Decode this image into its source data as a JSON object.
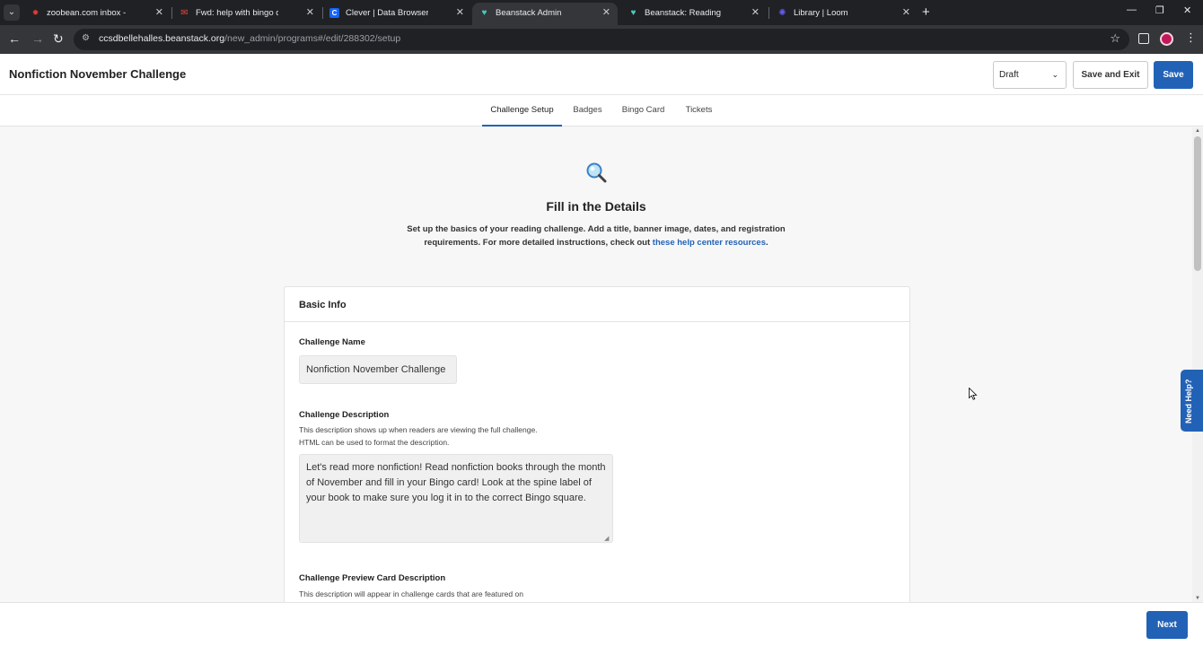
{
  "browser": {
    "tabs": [
      {
        "title": "zoobean.com inbox - App cras",
        "icon": "zoobean-icon",
        "active": false
      },
      {
        "title": "Fwd: help with bingo challeng",
        "icon": "gmail-icon",
        "active": false
      },
      {
        "title": "Clever | Data Browser",
        "icon": "clever-icon",
        "active": false
      },
      {
        "title": "Beanstack Admin",
        "icon": "beanstack-icon",
        "active": true
      },
      {
        "title": "Beanstack: Reading Challenges",
        "icon": "beanstack-icon",
        "active": false
      },
      {
        "title": "Library | Loom",
        "icon": "loom-icon",
        "active": false
      }
    ],
    "url_host": "ccsdbellehalles.beanstack.org",
    "url_path": "/new_admin/programs#/edit/288302/setup"
  },
  "header": {
    "title": "Nonfiction November Challenge",
    "status_value": "Draft",
    "save_exit_label": "Save and Exit",
    "save_label": "Save"
  },
  "content_tabs": [
    {
      "label": "Challenge Setup",
      "active": true
    },
    {
      "label": "Badges",
      "active": false
    },
    {
      "label": "Bingo Card",
      "active": false
    },
    {
      "label": "Tickets",
      "active": false
    }
  ],
  "intro": {
    "heading": "Fill in the Details",
    "text": "Set up the basics of your reading challenge. Add a title, banner image, dates, and registration requirements. For more detailed instructions, check out ",
    "link_text": "these help center resources",
    "text_end": "."
  },
  "basic_info": {
    "section_title": "Basic Info",
    "name_label": "Challenge Name",
    "name_value": "Nonfiction November Challenge",
    "description_label": "Challenge Description",
    "description_help": "This description shows up when readers are viewing the full challenge. HTML can be used to format the description.",
    "description_value": "Let's read more nonfiction! Read nonfiction books through the month of November and fill in your Bingo card! Look at the spine label of your book to make sure you log it in to the correct Bingo square.",
    "preview_label": "Challenge Preview Card Description",
    "preview_help": "This description will appear in challenge cards that are featured on"
  },
  "help_tab_label": "Need Help?",
  "footer": {
    "next_label": "Next"
  },
  "colors": {
    "primary": "#2262b6",
    "chrome_dark": "#202124"
  }
}
